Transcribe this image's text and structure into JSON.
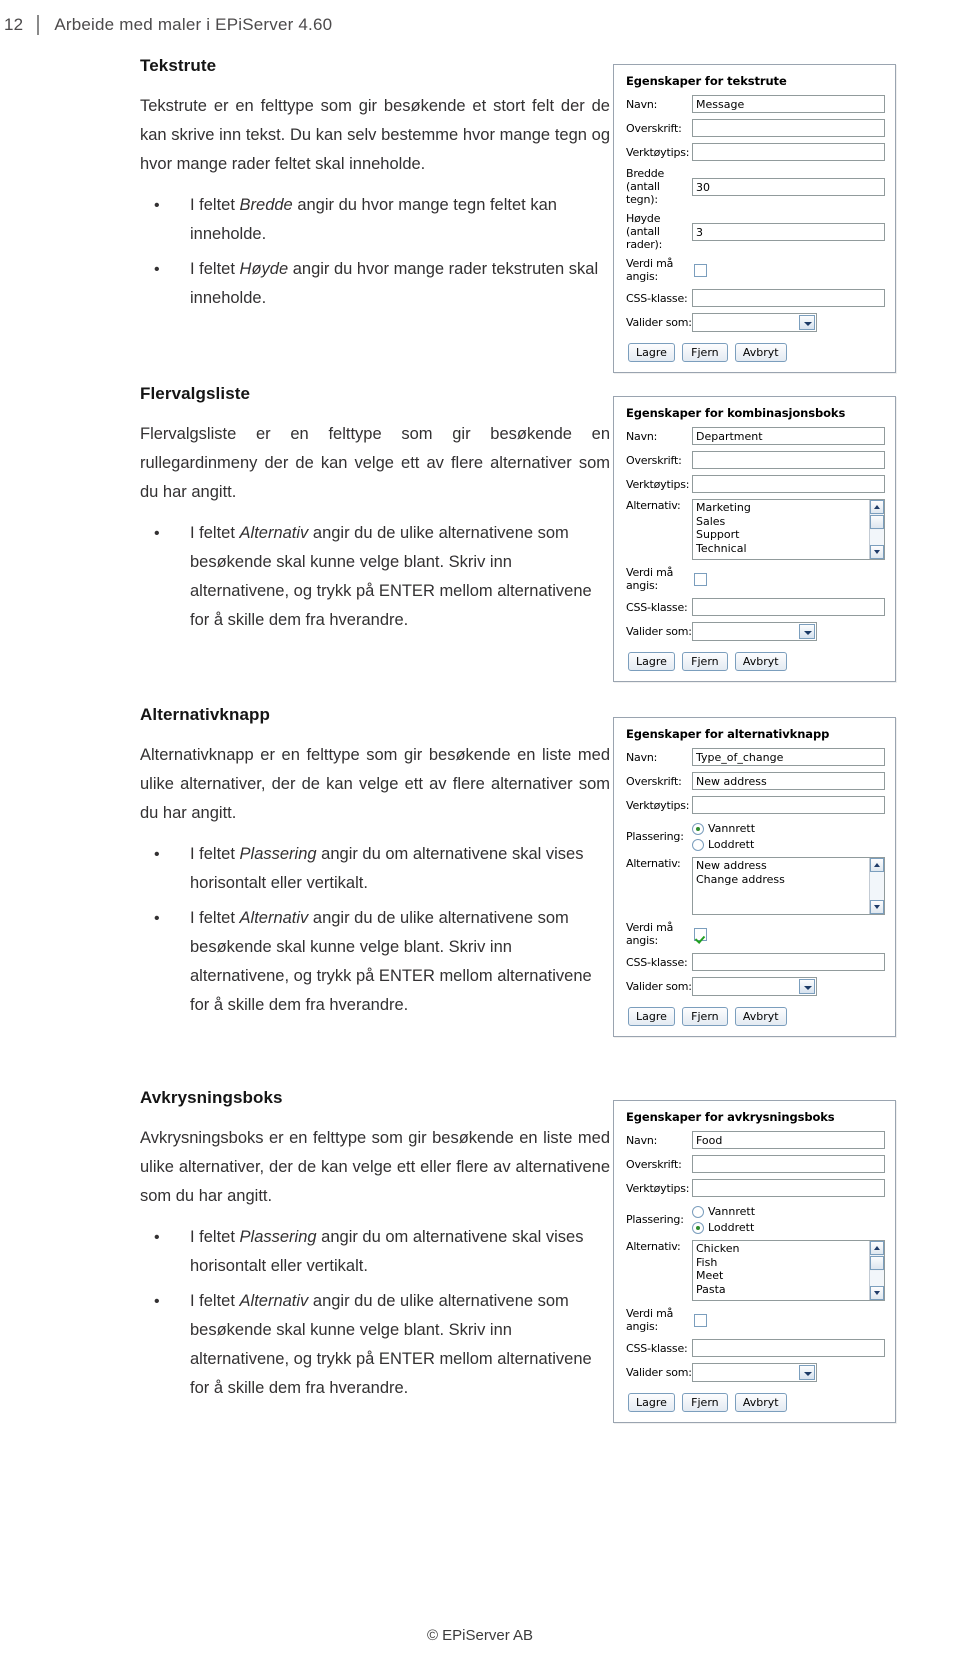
{
  "header": {
    "page_number": "12",
    "title": "Arbeide med maler i EPiServer 4.60"
  },
  "footer": {
    "copyright": "© EPiServer AB"
  },
  "dialog_common": {
    "label_navn": "Navn:",
    "label_overskrift": "Overskrift:",
    "label_verktoytips": "Verktøytips:",
    "label_verdi_ma_angis": "Verdi må angis:",
    "label_css_klasse": "CSS-klasse:",
    "label_valider_som": "Valider som:",
    "label_alternativ": "Alternativ:",
    "label_plassering": "Plassering:",
    "btn_lagre": "Lagre",
    "btn_fjern": "Fjern",
    "btn_avbryt": "Avbryt",
    "radio_vannrett": "Vannrett",
    "radio_loddrett": "Loddrett"
  },
  "sections": [
    {
      "title": "Tekstrute",
      "paragraph": "Tekstrute er en felttype som gir besøkende et stort felt der de kan skrive inn tekst. Du kan selv bestemme hvor mange tegn og hvor mange rader feltet skal inneholde.",
      "bullets": [
        {
          "pre": "I feltet ",
          "em": "Bredde",
          "post": " angir du hvor mange tegn feltet kan inneholde."
        },
        {
          "pre": "I feltet ",
          "em": "Høyde",
          "post": " angir du hvor mange rader tekstruten skal inneholde."
        }
      ]
    },
    {
      "title": "Flervalgsliste",
      "paragraph": "Flervalgsliste er en felttype som gir besøkende en rullegardinmeny der de kan velge ett av flere alternativer som du har angitt.",
      "bullets": [
        {
          "pre": "I feltet ",
          "em": "Alternativ",
          "post": " angir du de ulike alternativene som besøkende skal kunne velge blant. Skriv inn alternativene, og trykk på ENTER mellom alternativene for å skille dem fra hverandre."
        }
      ]
    },
    {
      "title": "Alternativknapp",
      "paragraph": "Alternativknapp er en felttype som gir besøkende en liste med ulike alternativer, der de kan velge ett av flere alternativer som du har angitt.",
      "bullets": [
        {
          "pre": "I feltet ",
          "em": "Plassering",
          "post": " angir du om alternativene skal vises horisontalt eller vertikalt."
        },
        {
          "pre": "I feltet ",
          "em": "Alternativ",
          "post": " angir du de ulike alternativene som besøkende skal kunne velge blant. Skriv inn alternativene, og trykk på ENTER mellom alternativene for å skille dem fra hverandre."
        }
      ]
    },
    {
      "title": "Avkrysningsboks",
      "paragraph": "Avkrysningsboks er en felttype som gir besøkende en liste med ulike alternativer, der de kan velge ett eller flere av alternativene som du har angitt.",
      "bullets": [
        {
          "pre": "I feltet ",
          "em": "Plassering",
          "post": " angir du om alternativene skal vises horisontalt eller vertikalt."
        },
        {
          "pre": "I feltet ",
          "em": "Alternativ",
          "post": " angir du de ulike alternativene som besøkende skal kunne velge blant. Skriv inn alternativene, og trykk på ENTER mellom alternativene for å skille dem fra hverandre."
        }
      ]
    }
  ],
  "dialogs": [
    {
      "title": "Egenskaper for tekstrute",
      "navn": "Message",
      "overskrift": "",
      "verktoytips": "",
      "label_bredde": "Bredde (antall tegn):",
      "bredde": "30",
      "label_hoyde": "Høyde (antall rader):",
      "hoyde": "3",
      "verdi_ma_angis": false,
      "css_klasse": "",
      "valider_som": ""
    },
    {
      "title": "Egenskaper for kombinasjonsboks",
      "navn": "Department",
      "overskrift": "",
      "verktoytips": "",
      "alternativ": [
        "Marketing",
        "Sales",
        "Support",
        "Technical"
      ],
      "verdi_ma_angis": false,
      "css_klasse": "",
      "valider_som": ""
    },
    {
      "title": "Egenskaper for alternativknapp",
      "navn": "Type_of_change",
      "overskrift": "New address",
      "verktoytips": "",
      "plassering": "Vannrett",
      "alternativ": [
        "New address",
        "Change address"
      ],
      "verdi_ma_angis": true,
      "css_klasse": "",
      "valider_som": ""
    },
    {
      "title": "Egenskaper for avkrysningsboks",
      "navn": "Food",
      "overskrift": "",
      "verktoytips": "",
      "plassering": "Loddrett",
      "alternativ": [
        "Chicken",
        "Fish",
        "Meet",
        "Pasta"
      ],
      "verdi_ma_angis": false,
      "css_klasse": "",
      "valider_som": ""
    }
  ]
}
